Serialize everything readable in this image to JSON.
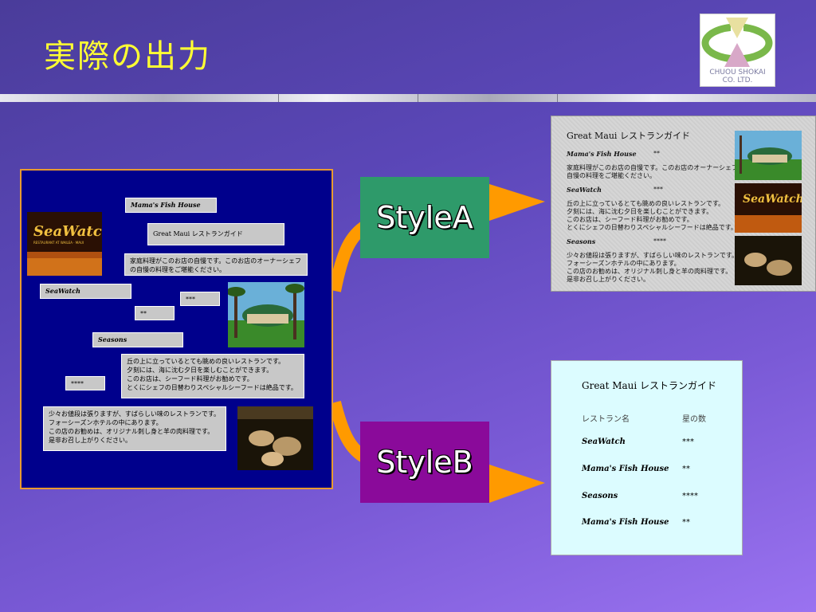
{
  "slide": {
    "title": "実際の出力"
  },
  "logo": {
    "line1": "CHUOU SHOKAI",
    "line2": "CO. LTD."
  },
  "source": {
    "mama_label": "Mama's Fish House",
    "guide_title": "Great Maui レストランガイド",
    "mama_desc": [
      "家庭料理がこのお店の自慢です。このお店のオーナーシェフ",
      "の自慢の料理をご堪能ください。"
    ],
    "seawatch_label": "SeaWatch",
    "seawatch_stars": "***",
    "mama_stars": "**",
    "seasons_label": "Seasons",
    "seawatch_desc": [
      "丘の上に立っているとても眺めの良いレストランです。",
      "夕刻には、海に沈む夕日を楽しむことができます。",
      "このお店は、シーフード料理がお勧めです。",
      "とくにシェフの日替わりスペシャルシーフードは絶品です。"
    ],
    "seasons_stars": "****",
    "seasons_desc": [
      "少々お値段は張りますが、すばらしい味のレストランです。",
      "フォーシーズンホテルの中にあります。",
      "この店のお勧めは、オリジナル刺し身と羊の肉料理です。",
      "是非お召し上がりください。"
    ],
    "sign_text": "SeaWatch",
    "sign_sub": "RESTAURANT AT WAILEA · MAUI"
  },
  "styleA": {
    "label": "StyleA"
  },
  "styleB": {
    "label": "StyleB"
  },
  "outputA": {
    "title": "Great Maui レストランガイド",
    "r1_name": "Mama's Fish House",
    "r1_stars": "**",
    "r1_desc": [
      "家庭料理がこのお店の自慢です。このお店のオーナーシェフの",
      "自慢の料理をご堪能ください。"
    ],
    "r2_name": "SeaWatch",
    "r2_stars": "***",
    "r2_desc": [
      "丘の上に立っているとても眺めの良いレストランです。",
      "夕刻には、海に沈む夕日を楽しむことができます。",
      "このお店は、シーフード料理がお勧めです。",
      "とくにシェフの日替わりスペシャルシーフードは絶品です。"
    ],
    "r3_name": "Seasons",
    "r3_stars": "****",
    "r3_desc": [
      "少々お値段は張りますが、すばらしい味のレストランです。",
      "フォーシーズンホテルの中にあります。",
      "この店のお勧めは、オリジナル刺し身と羊の肉料理です。",
      "是非お召し上がりください。"
    ],
    "sign_text": "SeaWatch"
  },
  "outputB": {
    "title": "Great Maui レストランガイド",
    "col_name": "レストラン名",
    "col_stars": "星の数",
    "rows": [
      {
        "name": "SeaWatch",
        "stars": "***"
      },
      {
        "name": "Mama's Fish House",
        "stars": "**"
      },
      {
        "name": "Seasons",
        "stars": "****"
      },
      {
        "name": "Mama's Fish House",
        "stars": "**"
      }
    ]
  },
  "colors": {
    "title": "#ffff33",
    "styleA": "#2e9a6a",
    "styleB": "#8a0a9a",
    "arrow": "#ff9a00",
    "panel": "#00008c"
  }
}
